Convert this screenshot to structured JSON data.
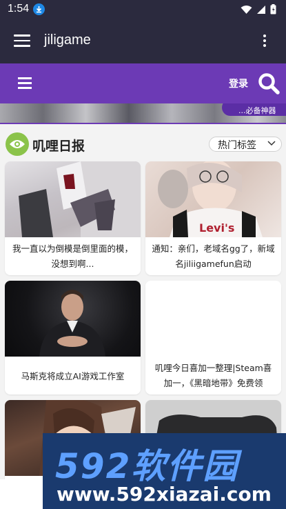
{
  "status": {
    "time": "1:54"
  },
  "app_bar": {
    "title": "jiligame"
  },
  "site_header": {
    "login": "登录"
  },
  "banner": {
    "tag_text": "...必备神器"
  },
  "section": {
    "title": "叽哩日报",
    "tag_filter": "热门标签"
  },
  "cards": [
    {
      "caption": "我一直以为倒模是倒里面的模，没想到啊..."
    },
    {
      "caption": "通知：亲们，老域名gg了，新域名jiliigamefun启动"
    },
    {
      "caption": "马斯克将成立AI游戏工作室"
    },
    {
      "caption": "叽哩今日喜加一整理|Steam喜加一，《黑暗地带》免费领"
    },
    {
      "caption": ""
    },
    {
      "caption": ""
    }
  ],
  "watermark": {
    "brand": "592软件园",
    "url": "www.592xiazai.com"
  },
  "colors": {
    "status_bg": "#2b2a3e",
    "header_purple": "#6c3ab5",
    "accent_green": "#8bc34a",
    "watermark_bg": "#1a3a6e"
  }
}
